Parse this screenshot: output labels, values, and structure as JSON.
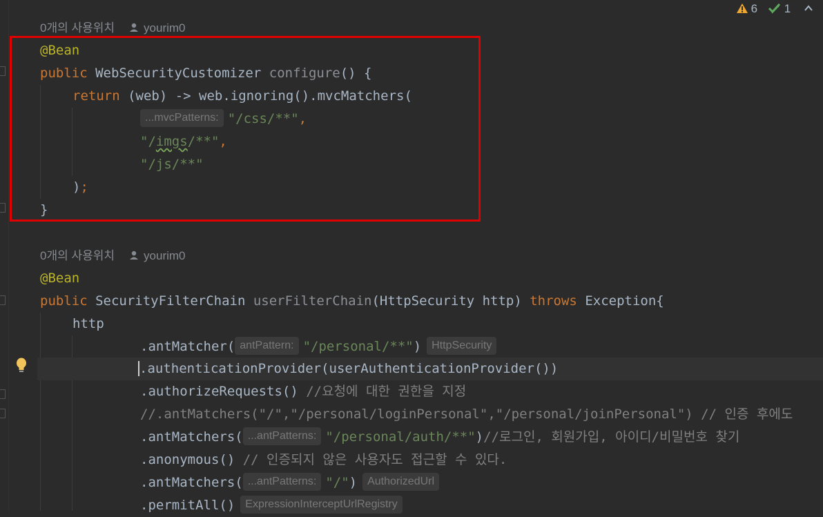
{
  "status": {
    "warnings": "6",
    "checks": "1"
  },
  "block1": {
    "usage": "0개의 사용위치",
    "author": "yourim0",
    "annotation": "@Bean",
    "sig_kw": "public ",
    "sig_type": "WebSecurityCustomizer ",
    "sig_method": "configure",
    "sig_rest": "() {",
    "return_kw": "return ",
    "return_rest": "(web) -> web.ignoring().mvcMatchers(",
    "hint1": "...mvcPatterns:",
    "str1": "\"/css/**\"",
    "comma1": ",",
    "str2a": "\"/",
    "str2b": "imgs",
    "str2c": "/**\"",
    "comma2": ",",
    "str3": "\"/js/**\"",
    "close_paren": ")",
    "close_semi": ";",
    "close_brace": "}"
  },
  "block2": {
    "usage": "0개의 사용위치",
    "author": "yourim0",
    "annotation": "@Bean",
    "sig_kw": "public ",
    "sig_type": "SecurityFilterChain ",
    "sig_method": "userFilterChain",
    "sig_params": "(HttpSecurity http) ",
    "throws_kw": "throws",
    "sig_end": " Exception{",
    "http": "http",
    "l1_a": ".antMatcher(",
    "l1_hint": "antPattern:",
    "l1_str": "\"/personal/**\"",
    "l1_b": ")",
    "l1_type": "HttpSecurity",
    "l2": ".authenticationProvider(userAuthenticationProvider())",
    "l3_a": ".authorizeRequests() ",
    "l3_cmt": "//요청에 대한 권한을 지정",
    "l4_cmt": "//.antMatchers(\"/\",\"/personal/loginPersonal\",\"/personal/joinPersonal\") // 인증 후에도",
    "l5_a": ".antMatchers(",
    "l5_hint": "...antPatterns:",
    "l5_str": "\"/personal/auth/**\"",
    "l5_b": ")",
    "l5_cmt": "//로그인, 회원가입, 아이디/비밀번호 찾기",
    "l6_a": ".anonymous() ",
    "l6_cmt": "// 인증되지 않은 사용자도 접근할 수 있다.",
    "l7_a": ".antMatchers(",
    "l7_hint": "...antPatterns:",
    "l7_str": "\"/\"",
    "l7_b": ")",
    "l7_type": "AuthorizedUrl",
    "l8_a": ".permitAll()",
    "l8_type": "ExpressionInterceptUrlRegistry"
  }
}
